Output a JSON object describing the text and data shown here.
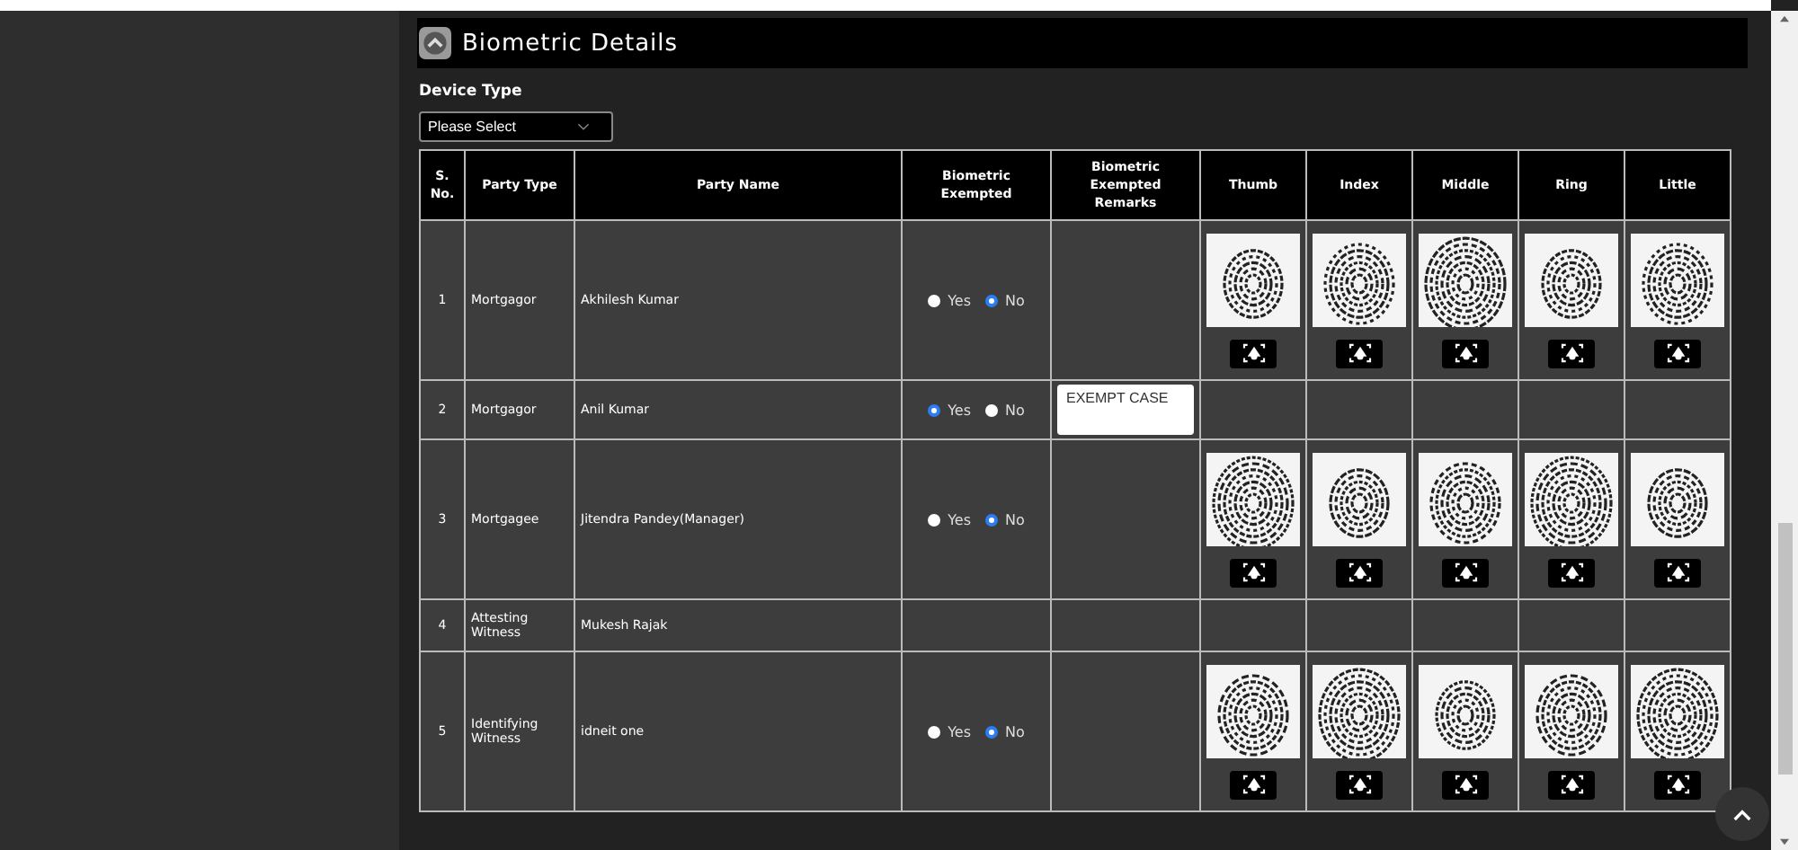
{
  "panel": {
    "title": "Biometric Details"
  },
  "device_type": {
    "label": "Device Type",
    "select": {
      "value": "Please Select"
    }
  },
  "table": {
    "columns": [
      "S. No.",
      "Party Type",
      "Party Name",
      "Biometric Exempted",
      "Biometric Exempted Remarks",
      "Thumb",
      "Index",
      "Middle",
      "Ring",
      "Little"
    ],
    "rows": [
      {
        "sno": "1",
        "party_type": "Mortgagor",
        "party_name": "Akhilesh Kumar",
        "options": [
          {
            "label": "Yes",
            "selected": false
          },
          {
            "label": "No",
            "selected": true
          }
        ],
        "fingerprints_captured": true
      },
      {
        "sno": "2",
        "party_type": "Mortgagor",
        "party_name": "Anil Kumar",
        "options": [
          {
            "label": "Yes",
            "selected": true
          },
          {
            "label": "No",
            "selected": false
          }
        ],
        "remarks": "EXEMPT CASE",
        "fingerprints_captured": false
      },
      {
        "sno": "3",
        "party_type": "Mortgagee",
        "party_name": "Jitendra Pandey(Manager)",
        "options": [
          {
            "label": "Yes",
            "selected": false
          },
          {
            "label": "No",
            "selected": true
          }
        ],
        "fingerprints_captured": true
      },
      {
        "sno": "4",
        "party_type": "Attesting Witness",
        "party_name": "Mukesh Rajak",
        "fingerprints_captured": false
      },
      {
        "sno": "5",
        "party_type": "Identifying Witness",
        "party_name": "idneit one",
        "options": [
          {
            "label": "Yes",
            "selected": false
          },
          {
            "label": "No",
            "selected": true
          }
        ],
        "fingerprints_captured": true
      }
    ]
  }
}
